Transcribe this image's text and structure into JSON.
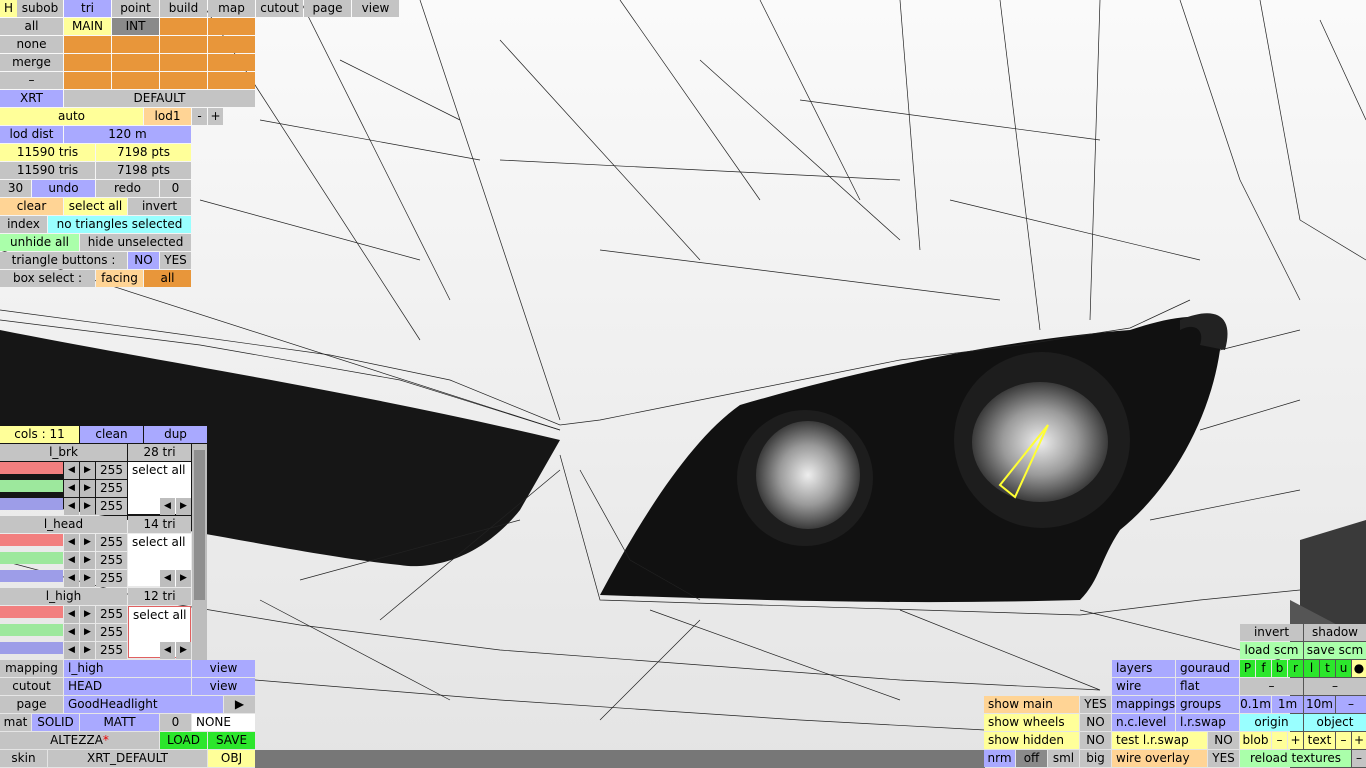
{
  "top_menu": {
    "h": "H",
    "items": [
      "subob",
      "tri",
      "point",
      "build",
      "map",
      "cutout",
      "page",
      "view"
    ]
  },
  "left_panel": {
    "all": "all",
    "main": "MAIN",
    "int": "INT",
    "none": "none",
    "merge": "merge",
    "dash": "–",
    "xrt": "XRT",
    "default": "DEFAULT",
    "auto": "auto",
    "lod1": "lod1",
    "minus": "-",
    "plus": "+",
    "lod_dist_label": "lod dist",
    "lod_dist_value": "120 m",
    "tris1": "11590 tris",
    "pts1": "7198 pts",
    "tris2": "11590 tris",
    "pts2": "7198 pts",
    "undo_count": "30",
    "undo": "undo",
    "redo": "redo",
    "redo_count": "0",
    "clear": "clear",
    "select_all": "select all",
    "invert": "invert",
    "index": "index",
    "selection_status": "no triangles selected",
    "unhide_all": "unhide all",
    "hide_unselected": "hide unselected",
    "triangle_buttons_label": "triangle buttons :",
    "no": "NO",
    "yes": "YES",
    "box_select_label": "box select :",
    "facing": "facing",
    "all_btn": "all"
  },
  "cols_panel": {
    "cols": "cols : 11",
    "clean": "clean",
    "dup": "dup",
    "layers": [
      {
        "name": "l_brk",
        "tri": "28 tri",
        "r": "255",
        "g": "255",
        "b": "255",
        "sel": "select all"
      },
      {
        "name": "l_head",
        "tri": "14 tri",
        "r": "255",
        "g": "255",
        "b": "255",
        "sel": "select all"
      },
      {
        "name": "l_high",
        "tri": "12 tri",
        "r": "255",
        "g": "255",
        "b": "255",
        "sel": "select all"
      }
    ],
    "left_arrow": "◀",
    "right_arrow": "▶"
  },
  "bottom_left": {
    "mapping_label": "mapping",
    "mapping_value": "l_high",
    "view1": "view",
    "cutout_label": "cutout",
    "cutout_value": "HEAD",
    "view2": "view",
    "page_label": "page",
    "page_value": "GoodHeadlight",
    "page_arrow": "▶",
    "mat": "mat",
    "solid": "SOLID",
    "matt": "MATT",
    "zero": "0",
    "none": "NONE",
    "model_name": "ALTEZZA",
    "model_star": "*",
    "load": "LOAD",
    "save": "SAVE",
    "skin": "skin",
    "xrt_default": "XRT_DEFAULT",
    "obj": "OBJ"
  },
  "bottom_right": {
    "show_main": "show main",
    "show_main_val": "YES",
    "show_wheels": "show wheels",
    "show_wheels_val": "NO",
    "show_hidden": "show hidden",
    "show_hidden_val": "NO",
    "nrm": "nrm",
    "off": "off",
    "sml": "sml",
    "big": "big",
    "layers": "layers",
    "gouraud": "gouraud",
    "wire": "wire",
    "flat": "flat",
    "mappings": "mappings",
    "groups": "groups",
    "nc_level": "n.c.level",
    "lr_swap": "l.r.swap",
    "test_lr_swap": "test l.r.swap",
    "test_lr_swap_val": "NO",
    "wire_overlay": "wire overlay",
    "wire_overlay_val": "YES",
    "invert": "invert",
    "shadow": "shadow",
    "load_scm": "load scm",
    "save_scm": "save scm",
    "flags": [
      "P",
      "f",
      "b",
      "r",
      "l",
      "t",
      "u",
      "●"
    ],
    "dash1": "–",
    "dash2": "–",
    "step1": "0.1m",
    "step2": "1m",
    "step3": "10m",
    "step_minus": "–",
    "origin": "origin",
    "object": "object",
    "blob": "blob",
    "blob_minus": "–",
    "blob_plus": "+",
    "text": "text",
    "text_minus": "–",
    "text_plus": "+",
    "reload_textures": "reload textures",
    "reload_minus": "–"
  }
}
